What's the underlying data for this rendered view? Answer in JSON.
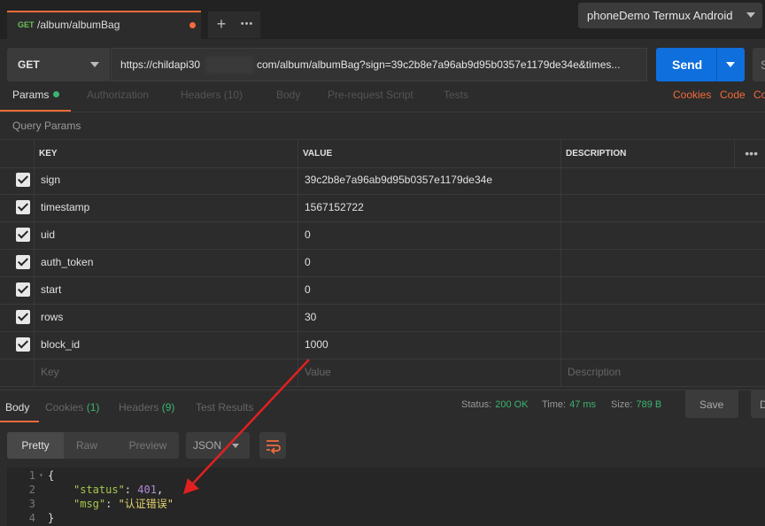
{
  "request_tab": {
    "method": "GET",
    "name": "/album/albumBag"
  },
  "tabbar": {
    "add": "+",
    "more": "•••"
  },
  "environment": "phoneDemo Termux Android",
  "url_bar": {
    "method": "GET",
    "url_prefix": "https://childapi30",
    "url_suffix": "com/album/albumBag?sign=39c2b8e7a96ab9d95b0357e1179de34e&times...",
    "send": "Send",
    "save_stub": "S"
  },
  "request_tabs": {
    "params": "Params",
    "authorization": "Authorization",
    "headers": "Headers (10)",
    "body": "Body",
    "prerequest": "Pre-request Script",
    "tests": "Tests",
    "cookies": "Cookies",
    "code": "Code",
    "comments": "Co"
  },
  "query_params": {
    "title": "Query Params",
    "columns": [
      "KEY",
      "VALUE",
      "DESCRIPTION"
    ],
    "more": "•••",
    "rows": [
      {
        "key": "sign",
        "value": "39c2b8e7a96ab9d95b0357e1179de34e",
        "checked": true
      },
      {
        "key": "timestamp",
        "value": "1567152722",
        "checked": true
      },
      {
        "key": "uid",
        "value": "0",
        "checked": true
      },
      {
        "key": "auth_token",
        "value": "0",
        "checked": true
      },
      {
        "key": "start",
        "value": "0",
        "checked": true
      },
      {
        "key": "rows",
        "value": "30",
        "checked": true
      },
      {
        "key": "block_id",
        "value": "1000",
        "checked": true
      }
    ],
    "placeholders": {
      "key": "Key",
      "value": "Value",
      "description": "Description"
    }
  },
  "response_tabs": {
    "body": "Body",
    "cookies": "Cookies",
    "cookies_count": "(1)",
    "headers": "Headers",
    "headers_count": "(9)",
    "tests": "Test Results"
  },
  "response_status": {
    "status_label": "Status:",
    "status_value": "200 OK",
    "time_label": "Time:",
    "time_value": "47 ms",
    "size_label": "Size:",
    "size_value": "789 B",
    "save": "Save",
    "download_stub": "D"
  },
  "view": {
    "pretty": "Pretty",
    "raw": "Raw",
    "preview": "Preview",
    "format": "JSON"
  },
  "code": {
    "lines": [
      {
        "num": "1",
        "text": "{"
      },
      {
        "num": "2",
        "key": "\"status\"",
        "sep": ": ",
        "val": "401",
        "end": ","
      },
      {
        "num": "3",
        "key": "\"msg\"",
        "sep": ": ",
        "val": "\"认证错误\"",
        "end": ""
      },
      {
        "num": "4",
        "text": "}"
      }
    ]
  },
  "colors": {
    "accent": "#f26b3a",
    "send": "#0f6fdd",
    "success": "#3cb371",
    "annotation_arrow": "#e02020"
  }
}
